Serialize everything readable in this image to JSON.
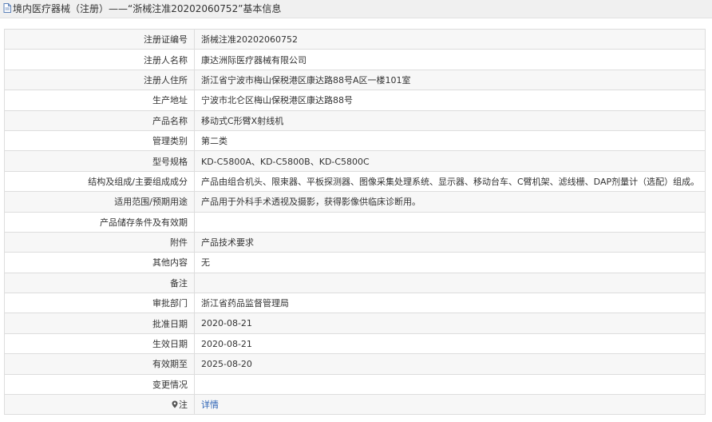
{
  "header": {
    "title": "境内医疗器械（注册）——“浙械注准20202060752”基本信息"
  },
  "rows": [
    {
      "label": "注册证编号",
      "value": "浙械注准20202060752"
    },
    {
      "label": "注册人名称",
      "value": "康达洲际医疗器械有限公司"
    },
    {
      "label": "注册人住所",
      "value": "浙江省宁波市梅山保税港区康达路88号A区一楼101室"
    },
    {
      "label": "生产地址",
      "value": "宁波市北仑区梅山保税港区康达路88号"
    },
    {
      "label": "产品名称",
      "value": "移动式C形臂X射线机"
    },
    {
      "label": "管理类别",
      "value": "第二类"
    },
    {
      "label": "型号规格",
      "value": "KD-C5800A、KD-C5800B、KD-C5800C"
    },
    {
      "label": "结构及组成/主要组成成分",
      "value": "产品由组合机头、限束器、平板探测器、图像采集处理系统、显示器、移动台车、C臂机架、滤线栅、DAP剂量计（选配）组成。"
    },
    {
      "label": "适用范围/预期用途",
      "value": "产品用于外科手术透视及摄影，获得影像供临床诊断用。"
    },
    {
      "label": "产品储存条件及有效期",
      "value": ""
    },
    {
      "label": "附件",
      "value": "产品技术要求"
    },
    {
      "label": "其他内容",
      "value": "无"
    },
    {
      "label": "备注",
      "value": ""
    },
    {
      "label": "审批部门",
      "value": "浙江省药品监督管理局"
    },
    {
      "label": "批准日期",
      "value": "2020-08-21"
    },
    {
      "label": "生效日期",
      "value": "2020-08-21"
    },
    {
      "label": "有效期至",
      "value": "2025-08-20"
    },
    {
      "label": "变更情况",
      "value": ""
    }
  ],
  "note_row": {
    "label": "注",
    "link_text": "详情",
    "icon": "map-pin-icon"
  },
  "colors": {
    "link": "#2b62b5",
    "border": "#dddddd",
    "odd_row": "#f7f7f7"
  }
}
